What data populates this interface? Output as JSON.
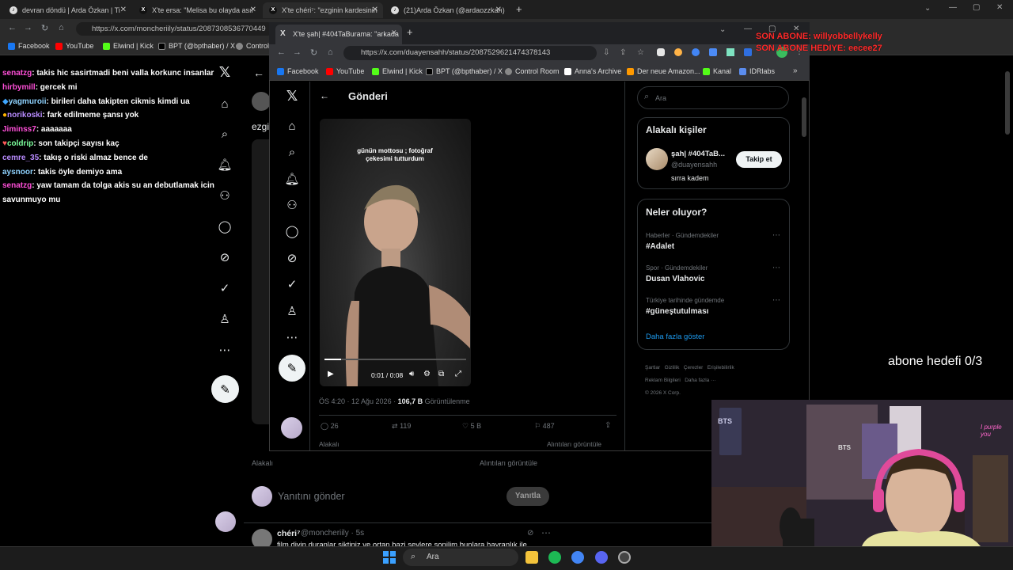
{
  "main_browser": {
    "tabs": [
      {
        "label": "devran döndü | Arda Özkan | Ti",
        "favicon": "tiktok-icon"
      },
      {
        "label": "X'te ersa: \"Melisa bu olayda asıl",
        "favicon": "x-icon"
      },
      {
        "label": "X'te chéri⁷: \"ezginin kardesinin",
        "favicon": "x-icon"
      },
      {
        "label": "(21)Arda Özkan (@ardaozzkan)",
        "favicon": "tiktok-icon"
      }
    ],
    "new_tab": "+",
    "url": "https://x.com/moncheriily/status/2087308536770449",
    "bookmarks": [
      "Facebook",
      "YouTube",
      "Elwind | Kick",
      "BPT (@bpthaber) / X",
      "Control"
    ]
  },
  "chat": [
    {
      "user": "senatzg",
      "color": "#ff4fd8",
      "text": ": takis hic sasirtmadi beni valla korkunc insanlar"
    },
    {
      "user": "hirbymill",
      "color": "#ff4fd8",
      "text": ": gercek mi"
    },
    {
      "user": "yagmuroii",
      "color": "#8fd3ff",
      "text": ": birileri daha takipten cikmis kimdi ua"
    },
    {
      "user": "norikoski",
      "color": "#b98cff",
      "text": ": fark edilmeme şansı yok"
    },
    {
      "user": "Jiminss7",
      "color": "#ff4fd8",
      "text": ": aaaaaaa"
    },
    {
      "user": "coldrip",
      "color": "#7cff9c",
      "text": ": son takipçi sayısı kaç"
    },
    {
      "user": "cemre_35",
      "color": "#b98cff",
      "text": ": takış o riski almaz bence de"
    },
    {
      "user": "aysnoor",
      "color": "#8fd3ff",
      "text": ": takis öyle demiyo ama"
    },
    {
      "user": "senatzg",
      "color": "#ff4fd8",
      "text": ": yaw tamam da tolga akis su an debutlamak icin savunmuyo mu"
    }
  ],
  "main_page": {
    "snippet": "ezgi",
    "alakali": "Alakalı",
    "alintilar": "Alıntıları görüntüle",
    "reply_placeholder": "Yanıtını gönder",
    "reply_button": "Yanıtla",
    "bottom_user": "chéri⁷",
    "bottom_handle": "@moncheriily · 5s",
    "bottom_text": "film divin duranlar siktiniz ve ortan bazi seylere sonilim bunlara hayranlık ile"
  },
  "popup": {
    "tab_label": "X'te şah| #404TaBurama: \"arkada",
    "url": "https://x.com/duayensahh/status/2087529621474378143",
    "bookmarks": [
      "Facebook",
      "YouTube",
      "Elwind | Kick",
      "BPT (@bpthaber) / X",
      "Control Room",
      "Anna's Archive",
      "Der neue Amazon...",
      "Kanal",
      "IDRlabs"
    ],
    "header_title": "Gönderi",
    "video_caption": "günün mottosu ; fotoğraf çekesimi tutturdum",
    "video_time": "0:01 / 0:08",
    "post_meta": "ÖS 4:20 · 12 Ağu 2026 · ",
    "views_count": "106,7 B",
    "views_label": "Görüntülenme",
    "actions": {
      "replies": "26",
      "reposts": "119",
      "likes": "5 B",
      "bookmarks": "487"
    },
    "alakali": "Alakalı",
    "alintilar": "Alıntıları görüntüle",
    "search_placeholder": "Ara",
    "related_title": "Alakalı kişiler",
    "related_name": "şah| #404TaB...",
    "related_handle": "@duayensahh",
    "related_bio": "sırra kadem",
    "follow_button": "Takip et",
    "trends_title": "Neler oluyor?",
    "trends": [
      {
        "category": "Haberler · Gündemdekiler",
        "name": "#Adalet"
      },
      {
        "category": "Spor · Gündemdekiler",
        "name": "Dusan Vlahovic"
      },
      {
        "category": "Türkiye tarihinde gündemde",
        "name": "#güneştutulması"
      }
    ],
    "show_more": "Daha fazla göster",
    "footer": [
      "Şartlar",
      "Gizlilik",
      "Çerezler",
      "Erişilebilirlik",
      "Reklam Bilgileri",
      "Daha fazla ···",
      "© 2026 X Corp."
    ]
  },
  "overlay": {
    "son_abone": "SON ABONE: willyobbellykelly",
    "son_abone_hediye": "SON ABONE HEDIYE: eecee27",
    "abone_hedefi": "abone hedefi 0/3"
  },
  "taskbar": {
    "search": "Ara"
  }
}
